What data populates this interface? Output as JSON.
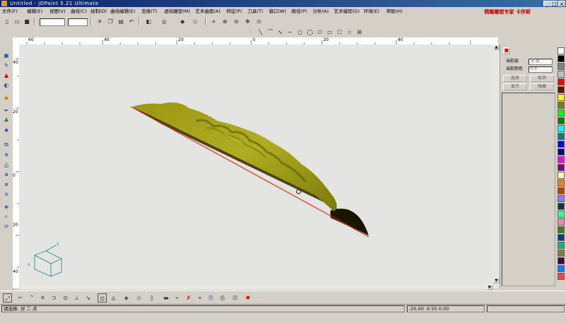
{
  "window": {
    "title": "Untitled - JDPaint 5.21 Ultimate"
  },
  "menu": {
    "items": [
      "文件(F)",
      "编辑(E)",
      "视图(V)",
      "曲线(C)",
      "绘制(D)",
      "曲线编辑(E)",
      "变换(T)",
      "虚拟雕塑(M)",
      "艺术曲面(A)",
      "特征(P)",
      "刀具(T)",
      "窗口(W)",
      "路径(P)",
      "分析(A)",
      "艺术编程(O)",
      "环境(E)",
      "帮助(H)"
    ],
    "brand": "精雕雕塑专家 卡伴斯"
  },
  "toolbar1": {
    "zoom_combo_value": "",
    "icons": [
      "new-icon",
      "open-icon",
      "save-icon",
      "cut-icon",
      "copy-icon",
      "paste-icon",
      "undo-icon",
      "redo-icon",
      "view-icon"
    ]
  },
  "ruler": {
    "h_labels": [
      "60",
      "40",
      "20",
      "0",
      "20",
      "40"
    ],
    "v_labels": [
      "40",
      "20",
      "0",
      "20",
      "40"
    ]
  },
  "right_panel": {
    "rows": [
      {
        "label": "当前层",
        "value": "无 层"
      },
      {
        "label": "当前颜色",
        "value": "0  0"
      }
    ],
    "buttons": [
      [
        "选择",
        "取消"
      ],
      [
        "显示",
        "隐藏"
      ]
    ]
  },
  "palette": {
    "colors": [
      "#ffffff",
      "#000000",
      "#808080",
      "#c0c0c0",
      "#ff0000",
      "#800000",
      "#ffff00",
      "#808000",
      "#00ff00",
      "#008000",
      "#00ffff",
      "#008080",
      "#0000ff",
      "#000080",
      "#ff00ff",
      "#800080",
      "#ffffc0",
      "#ff8000",
      "#c04000",
      "#8080ff",
      "#004040",
      "#40ff80",
      "#ff80c0",
      "#408000",
      "#004080",
      "#00c080",
      "#808040",
      "#400040",
      "#0080ff",
      "#ff4040"
    ]
  },
  "status": {
    "left": "请选择: 对 二 点",
    "coords": "-20.00 -0.55 0.00"
  },
  "accent": {
    "model_fill": "#8d8c0f",
    "model_side": "#5a4f08",
    "edge": "#d03010",
    "title_bar": "#0a246a"
  }
}
